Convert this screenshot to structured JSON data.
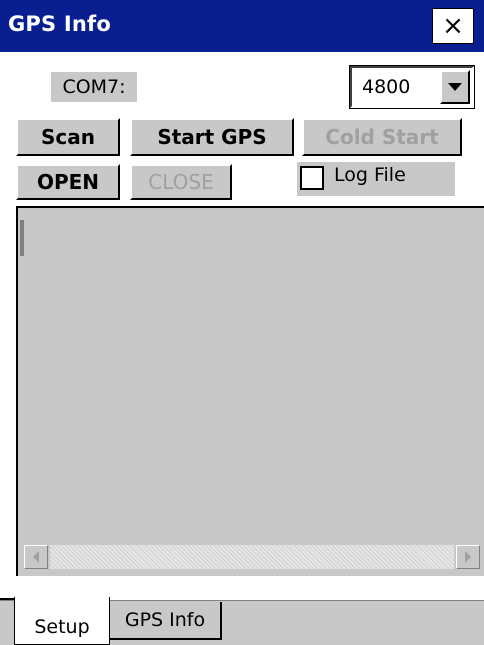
{
  "window": {
    "title": "GPS Info",
    "close_label": "×"
  },
  "setup": {
    "com_label": "COM7:",
    "baud_rate": "4800",
    "buttons": {
      "scan": "Scan",
      "start_gps": "Start GPS",
      "cold_start": "Cold Start",
      "open": "OPEN",
      "close": "CLOSE"
    },
    "log_file_label": "Log File",
    "log_file_checked": false
  },
  "tabs": [
    {
      "label": "Setup",
      "active": true
    },
    {
      "label": "GPS Info",
      "active": false
    }
  ]
}
